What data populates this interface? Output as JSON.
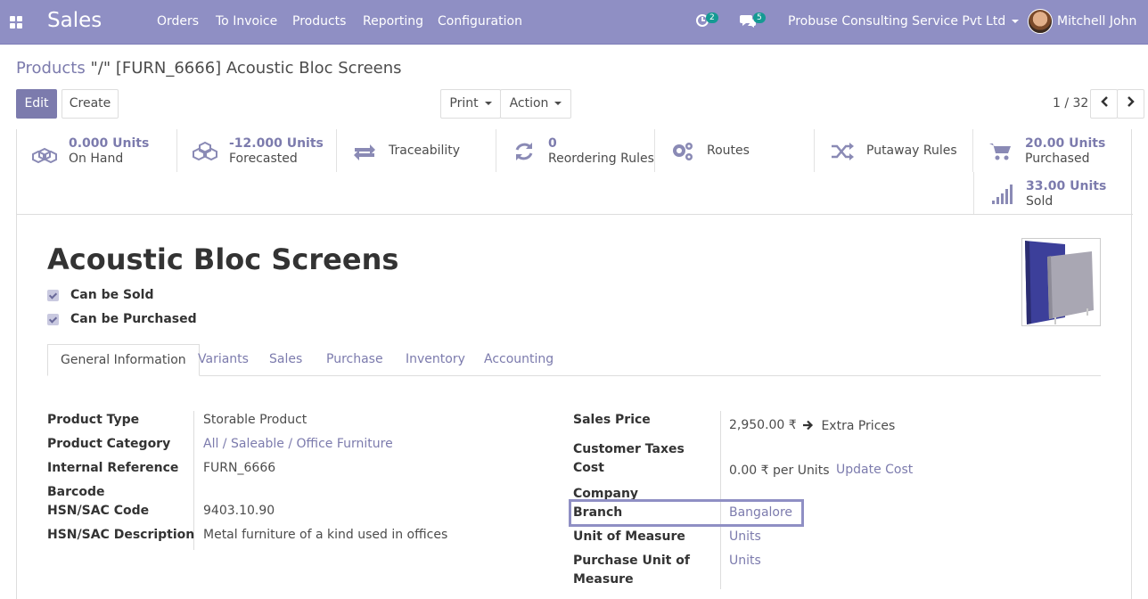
{
  "navbar": {
    "brand": "Sales",
    "menu": [
      "Orders",
      "To Invoice",
      "Products",
      "Reporting",
      "Configuration"
    ],
    "activity_count": "2",
    "messages_count": "5",
    "company": "Probuse Consulting Service Pvt Ltd",
    "user": "Mitchell John"
  },
  "breadcrumb": {
    "parent": "Products",
    "current": "\"/\" [FURN_6666] Acoustic Bloc Screens"
  },
  "control": {
    "edit": "Edit",
    "create": "Create",
    "print": "Print",
    "action": "Action",
    "pager": "1 / 32"
  },
  "stats": {
    "on_hand_value": "0.000 Units",
    "on_hand_label": "On Hand",
    "forecasted_value": "-12.000 Units",
    "forecasted_label": "Forecasted",
    "traceability": "Traceability",
    "reordering_value": "0",
    "reordering_label": "Reordering Rules",
    "routes": "Routes",
    "putaway": "Putaway Rules",
    "purchased_value": "20.00 Units",
    "purchased_label": "Purchased",
    "sold_value": "33.00 Units",
    "sold_label": "Sold"
  },
  "product": {
    "name": "Acoustic Bloc Screens",
    "can_be_sold": "Can be Sold",
    "can_be_purchased": "Can be Purchased"
  },
  "tabs": [
    "General Information",
    "Variants",
    "Sales",
    "Purchase",
    "Inventory",
    "Accounting"
  ],
  "left_fields": {
    "product_type_label": "Product Type",
    "product_type": "Storable Product",
    "category_label": "Product Category",
    "category": "All / Saleable / Office Furniture",
    "internal_ref_label": "Internal Reference",
    "internal_ref": "FURN_6666",
    "barcode_label": "Barcode",
    "hsn_code_label": "HSN/SAC Code",
    "hsn_code": "9403.10.90",
    "hsn_desc_label": "HSN/SAC Description",
    "hsn_desc": "Metal furniture of a kind used in offices"
  },
  "right_fields": {
    "sales_price_label": "Sales Price",
    "sales_price": "2,950.00 ₹",
    "extra_prices": "Extra Prices",
    "customer_taxes_label": "Customer Taxes",
    "cost_label": "Cost",
    "cost": "0.00 ₹",
    "cost_unit": "per Units",
    "update_cost": "Update Cost",
    "company_label": "Company",
    "branch_label": "Branch",
    "branch": "Bangalore",
    "uom_label": "Unit of Measure",
    "uom": "Units",
    "purchase_uom_label_1": "Purchase Unit of",
    "purchase_uom_label_2": "Measure",
    "purchase_uom": "Units"
  }
}
